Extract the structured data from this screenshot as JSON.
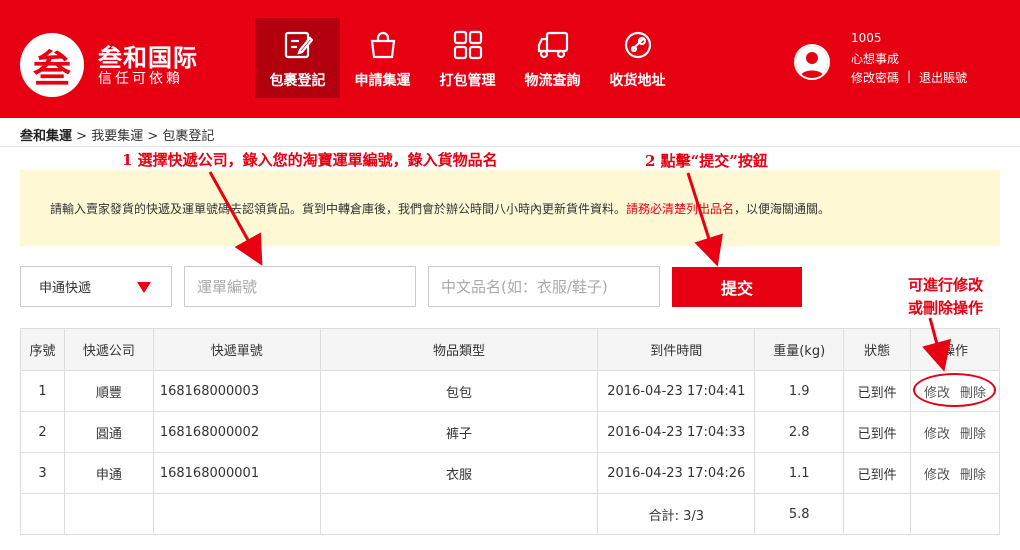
{
  "brand": {
    "logo_char": "叁",
    "name": "叁和国际",
    "slogan": "信任可依賴"
  },
  "nav": [
    {
      "label": "包裹登記",
      "icon": "edit-icon",
      "active": true
    },
    {
      "label": "申請集運",
      "icon": "bag-icon",
      "active": false
    },
    {
      "label": "打包管理",
      "icon": "grid-icon",
      "active": false
    },
    {
      "label": "物流查詢",
      "icon": "truck-icon",
      "active": false
    },
    {
      "label": "收货地址",
      "icon": "map-icon",
      "active": false
    }
  ],
  "user": {
    "id": "1005",
    "name": "心想事成",
    "change_password": "修改密碼",
    "separator": "|",
    "logout": "退出賬號"
  },
  "breadcrumb": {
    "root": "叁和集運",
    "sep1": " > ",
    "level2": "我要集運",
    "sep2": " > ",
    "current": "包裹登記"
  },
  "annotations": {
    "step1": "1 選擇快遞公司，錄入您的淘寶運單編號，錄入貨物品名",
    "step2": "2 點擊“提交”按鈕",
    "op_line1": "可進行修改",
    "op_line2": "或刪除操作"
  },
  "notice": {
    "text": "請輸入賣家發貨的快遞及運單號碼去認領貨品。貨到中轉倉庫後，我們會於辦公時間八小時內更新貨件資料。",
    "highlight": "請務必清楚列出品名",
    "tail": "，以便海關通關。"
  },
  "form": {
    "courier_selected": "申通快遞",
    "tracking_placeholder": "運單編號",
    "item_placeholder": "中文品名(如：衣服/鞋子)",
    "submit_label": "提交"
  },
  "table": {
    "headers": [
      "序號",
      "快遞公司",
      "快遞單號",
      "物品類型",
      "到件時間",
      "重量(kg)",
      "狀態",
      "操作"
    ],
    "rows": [
      {
        "no": "1",
        "courier": "順豐",
        "tracking": "168168000003",
        "item": "包包",
        "time": "2016-04-23 17:04:41",
        "weight": "1.9",
        "status": "已到件",
        "edit": "修改",
        "delete": "刪除"
      },
      {
        "no": "2",
        "courier": "圓通",
        "tracking": "168168000002",
        "item": "裤子",
        "time": "2016-04-23 17:04:33",
        "weight": "2.8",
        "status": "已到件",
        "edit": "修改",
        "delete": "刪除"
      },
      {
        "no": "3",
        "courier": "申通",
        "tracking": "168168000001",
        "item": "衣服",
        "time": "2016-04-23 17:04:26",
        "weight": "1.1",
        "status": "已到件",
        "edit": "修改",
        "delete": "刪除"
      }
    ],
    "total_label": "合計: 3/3",
    "total_weight": "5.8"
  },
  "colors": {
    "brand_red": "#e60012",
    "nav_active": "#b3000e",
    "notice_bg": "#fff8d5"
  }
}
